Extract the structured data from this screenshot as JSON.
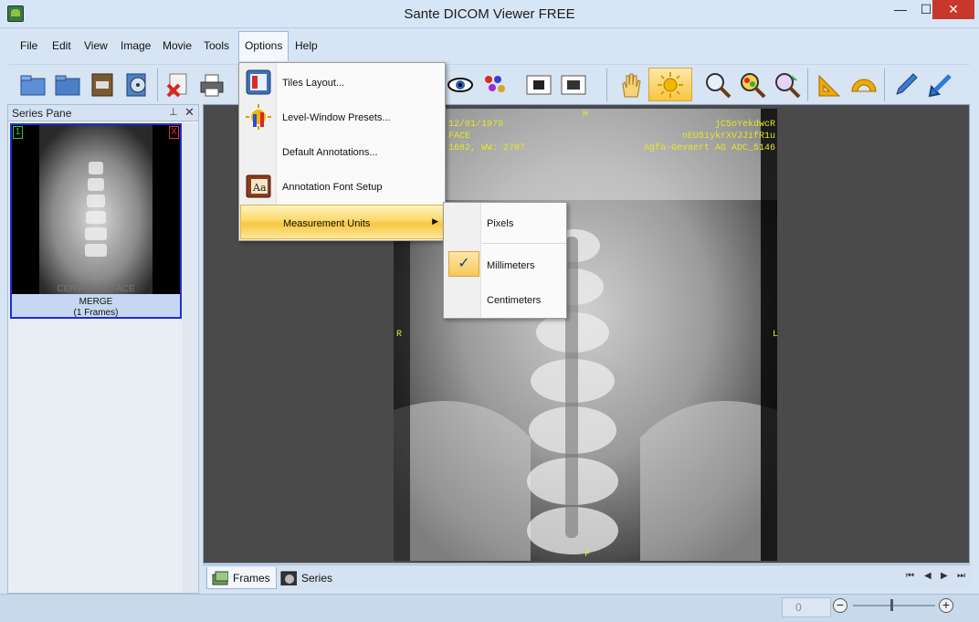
{
  "window": {
    "title": "Sante DICOM Viewer FREE",
    "minimize": "—",
    "maximize": "☐",
    "close": "✕"
  },
  "menu": [
    "File",
    "Edit",
    "View",
    "Image",
    "Movie",
    "Tools",
    "Options",
    "Help"
  ],
  "series_pane": {
    "title": "Series Pane",
    "pin": "⊥",
    "close": "✕",
    "thumbnail": {
      "index": "1",
      "remove": "X",
      "caption": "CERVICALE FACE",
      "name": "MERGE",
      "frames": "(1 Frames)"
    }
  },
  "viewer": {
    "top_left_1": "12/01/1979",
    "top_left_2": "FACE",
    "top_left_3": "1682, WW: 2707",
    "top_right_1": "jC5oYekdwcR",
    "top_right_2": "nEU51ykrXVJJifR1u",
    "top_right_3": "Agfa-Gevaert AG ADC_5146",
    "orient_top": "H",
    "orient_left": "R",
    "orient_right": "L",
    "orient_bottom": "F"
  },
  "options_menu": {
    "items": [
      {
        "label": "Tiles Layout...",
        "icon": "tiles-layout-icon"
      },
      {
        "label": "Level-Window Presets...",
        "icon": "level-window-icon"
      },
      {
        "label": "Default Annotations...",
        "icon": ""
      },
      {
        "label": "Annotation Font Setup",
        "icon": "font-book-icon"
      },
      {
        "label": "Measurement Units",
        "icon": "",
        "highlighted": true
      }
    ]
  },
  "units_submenu": {
    "items": [
      {
        "label": "Pixels",
        "checked": false
      },
      {
        "label": "Millimeters",
        "checked": true
      },
      {
        "label": "Centimeters",
        "checked": false
      }
    ],
    "check_mark": "✓"
  },
  "tabs": [
    "Frames",
    "Series"
  ],
  "status": {
    "zoom_value": "0",
    "zoom_out": "−",
    "zoom_in": "+"
  },
  "colors": {
    "overlay_text": "#e6e62a",
    "highlight": "#f8c640",
    "frame_border": "#1e2ed6"
  }
}
